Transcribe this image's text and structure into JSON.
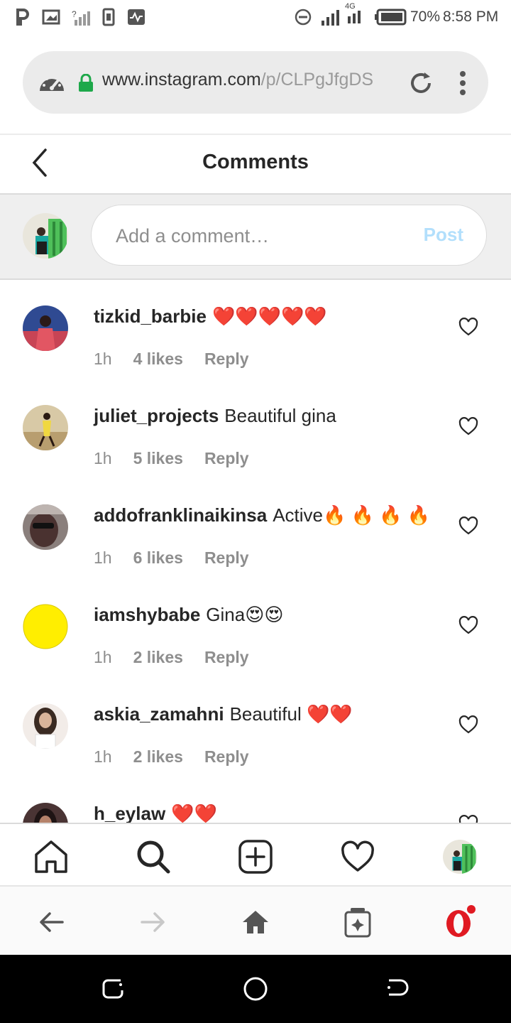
{
  "status_bar": {
    "battery": "70%",
    "time": "8:58 PM",
    "network": "4G",
    "icons": [
      "parking-icon",
      "screenshot-icon",
      "no-signal-icon",
      "sim-icon",
      "activity-icon",
      "do-not-disturb-icon",
      "signal-icon",
      "data-icon",
      "battery-icon"
    ]
  },
  "browser": {
    "url_main": "www.instagram.com",
    "url_rest": "/p/CLPgJfgDS",
    "icons": [
      "speed-dial-icon",
      "lock-icon",
      "reload-icon",
      "more-vert-icon"
    ]
  },
  "header": {
    "title": "Comments"
  },
  "composer": {
    "placeholder": "Add a comment…",
    "post_label": "Post"
  },
  "comments": [
    {
      "username": "tizkid_barbie",
      "text": "❤️❤️❤️❤️❤️",
      "time": "1h",
      "likes": "4 likes",
      "reply": "Reply",
      "avatar_color": "#d04f5e"
    },
    {
      "username": "juliet_projects",
      "text": "Beautiful gina",
      "time": "1h",
      "likes": "5 likes",
      "reply": "Reply",
      "avatar_color": "#c9b27d"
    },
    {
      "username": "addofranklinaikinsa",
      "text": "Active🔥 🔥 🔥 🔥",
      "time": "1h",
      "likes": "6 likes",
      "reply": "Reply",
      "avatar_color": "#7a6a66"
    },
    {
      "username": "iamshybabe",
      "text": "Gina😍😍",
      "time": "1h",
      "likes": "2 likes",
      "reply": "Reply",
      "avatar_color": "#ffee00"
    },
    {
      "username": "askia_zamahni",
      "text": "Beautiful ❤️❤️",
      "time": "1h",
      "likes": "2 likes",
      "reply": "Reply",
      "avatar_color": "#e6dcd6"
    },
    {
      "username": "h_eylaw",
      "text": "❤️❤️",
      "time": "",
      "likes": "",
      "reply": "",
      "avatar_color": "#3a2a2a"
    }
  ],
  "tabbar": {
    "icons": [
      "home-icon",
      "search-icon",
      "new-post-icon",
      "activity-heart-icon",
      "profile-avatar"
    ]
  },
  "browser_nav": {
    "icons": [
      "back-icon",
      "forward-icon",
      "home-icon",
      "tabs-icon",
      "opera-icon"
    ]
  },
  "colors": {
    "accent_post_disabled": "#b2dffc",
    "heart": "#e0112b",
    "opera_red": "#e01a22",
    "lock_green": "#1ea84a"
  }
}
